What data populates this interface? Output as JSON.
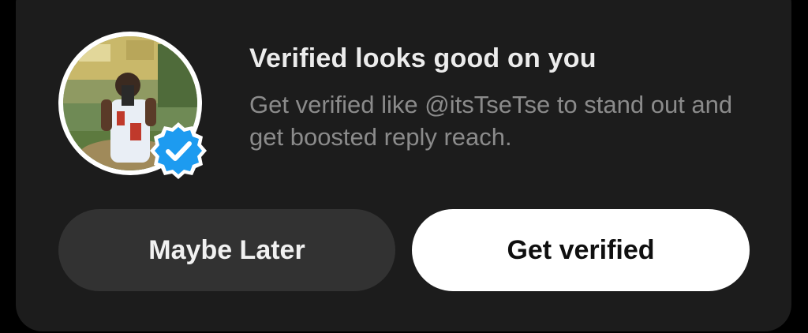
{
  "prompt": {
    "title": "Verified looks good on you",
    "subtitle": "Get verified like @itsTseTse to stand out and get boosted reply reach."
  },
  "buttons": {
    "maybe_later": "Maybe Later",
    "get_verified": "Get verified"
  },
  "icons": {
    "badge": "verified-checkmark-icon",
    "avatar": "user-avatar"
  },
  "colors": {
    "background": "#000000",
    "card": "#1c1c1c",
    "title": "#ececec",
    "subtitle": "#8b8b8b",
    "secondary_button": "#323232",
    "primary_button": "#ffffff",
    "badge_blue": "#1d9bf0"
  }
}
